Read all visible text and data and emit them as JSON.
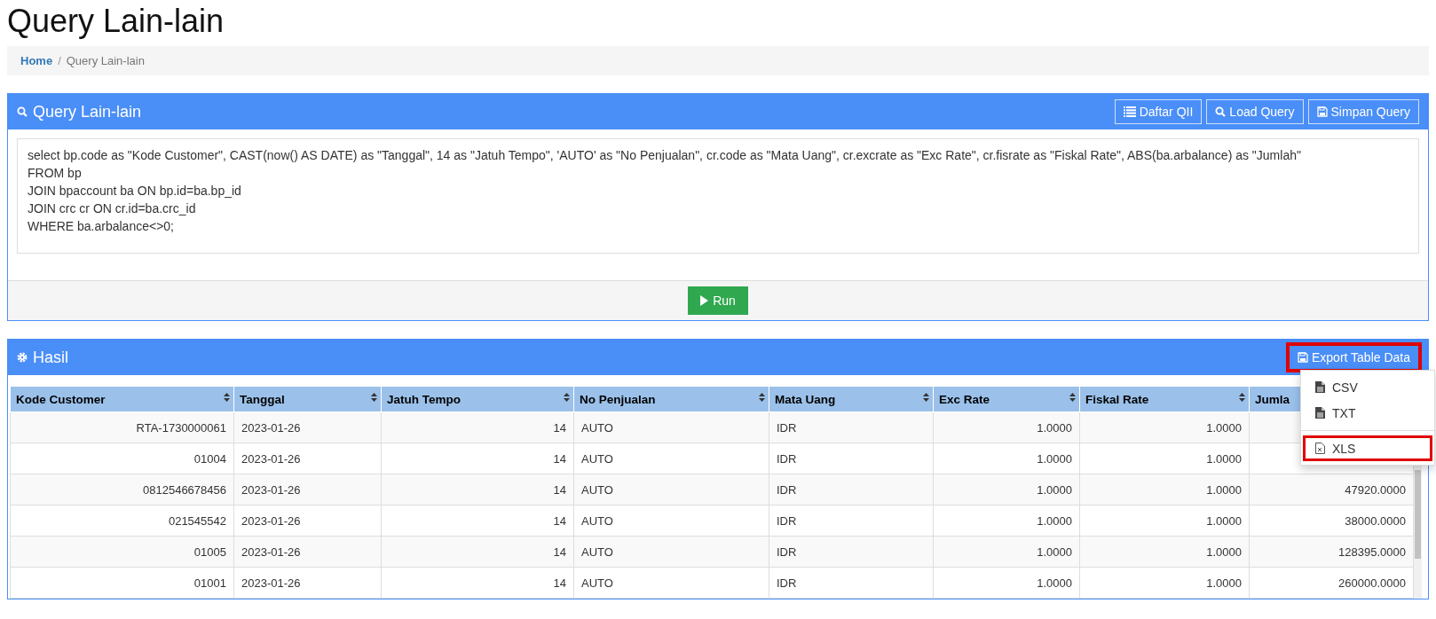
{
  "page_title": "Query Lain-lain",
  "breadcrumb": [
    {
      "label": "Home",
      "link": true
    },
    {
      "label": "Query Lain-lain",
      "link": false
    }
  ],
  "breadcrumb_separator": "/",
  "query_panel": {
    "title": "Query Lain-lain",
    "buttons": [
      {
        "label": "Daftar QII"
      },
      {
        "label": "Load Query"
      },
      {
        "label": "Simpan Query"
      }
    ],
    "query_lines": [
      "select bp.code as \"Kode Customer\", CAST(now() AS DATE) as \"Tanggal\", 14 as \"Jatuh Tempo\", 'AUTO' as \"No Penjualan\", cr.code as \"Mata Uang\", cr.excrate as \"Exc Rate\", cr.fisrate as \"Fiskal Rate\", ABS(ba.arbalance) as \"Jumlah\"",
      "FROM bp",
      "JOIN bpaccount ba ON bp.id=ba.bp_id",
      "JOIN crc cr ON cr.id=ba.crc_id",
      "WHERE ba.arbalance<>0;"
    ],
    "run_button": "Run"
  },
  "result_panel": {
    "title": "Hasil",
    "export_button": {
      "label": "Export Table Data",
      "highlighted": true
    },
    "export_menu": [
      {
        "kind": "file",
        "label": "CSV",
        "highlighted": false
      },
      {
        "kind": "file",
        "label": "TXT",
        "highlighted": false
      },
      {
        "kind": "divider"
      },
      {
        "kind": "spreadsheet",
        "label": "XLS",
        "highlighted": true
      }
    ],
    "table": {
      "columns": [
        {
          "label": "Kode Customer"
        },
        {
          "label": "Tanggal"
        },
        {
          "label": "Jatuh Tempo"
        },
        {
          "label": "No Penjualan"
        },
        {
          "label": "Mata Uang"
        },
        {
          "label": "Exc Rate"
        },
        {
          "label": "Fiskal Rate"
        },
        {
          "label": "Jumla"
        }
      ],
      "rows": [
        [
          "RTA-1730000061",
          "2023-01-26",
          "14",
          "AUTO",
          "IDR",
          "1.0000",
          "1.0000",
          null
        ],
        [
          "01004",
          "2023-01-26",
          "14",
          "AUTO",
          "IDR",
          "1.0000",
          "1.0000",
          null
        ],
        [
          "0812546678456",
          "2023-01-26",
          "14",
          "AUTO",
          "IDR",
          "1.0000",
          "1.0000",
          "47920.0000"
        ],
        [
          "021545542",
          "2023-01-26",
          "14",
          "AUTO",
          "IDR",
          "1.0000",
          "1.0000",
          "38000.0000"
        ],
        [
          "01005",
          "2023-01-26",
          "14",
          "AUTO",
          "IDR",
          "1.0000",
          "1.0000",
          "128395.0000"
        ],
        [
          "01001",
          "2023-01-26",
          "14",
          "AUTO",
          "IDR",
          "1.0000",
          "1.0000",
          "260000.0000"
        ]
      ]
    }
  }
}
